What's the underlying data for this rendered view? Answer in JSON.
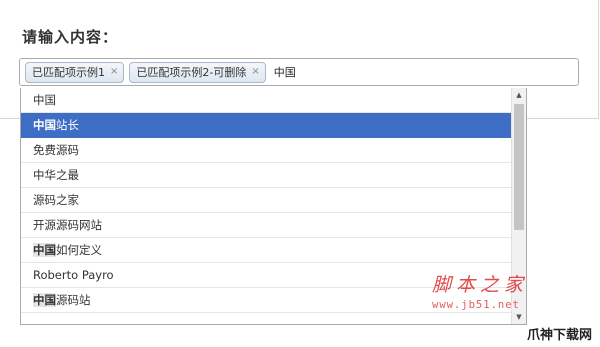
{
  "form": {
    "title": "请输入内容："
  },
  "tag_input": {
    "chips": [
      {
        "label": "已匹配项示例1",
        "remove_glyph": "×"
      },
      {
        "label": "已匹配项示例2-可删除",
        "remove_glyph": "×"
      }
    ],
    "typed_value": "中国"
  },
  "dropdown": {
    "highlighted_index": 1,
    "items": [
      {
        "match": "",
        "rest": "中国"
      },
      {
        "match": "中国",
        "rest": "站长"
      },
      {
        "match": "",
        "rest": "免费源码"
      },
      {
        "match": "",
        "rest": "中华之最"
      },
      {
        "match": "",
        "rest": "源码之家"
      },
      {
        "match": "",
        "rest": "开源源码网站"
      },
      {
        "match": "中国",
        "rest": "如何定义"
      },
      {
        "match": "",
        "rest": "Roberto Payro"
      },
      {
        "match": "中国",
        "rest": "源码站"
      }
    ],
    "scroll_up_icon": "▲",
    "scroll_down_icon": "▼"
  },
  "watermark": {
    "title": "脚本之家",
    "url": "www.jb51.net"
  },
  "corner_logo": {
    "text": "爪神下载网"
  },
  "colors": {
    "highlight": "#3d6dc5",
    "watermark": "#e24a4a"
  }
}
